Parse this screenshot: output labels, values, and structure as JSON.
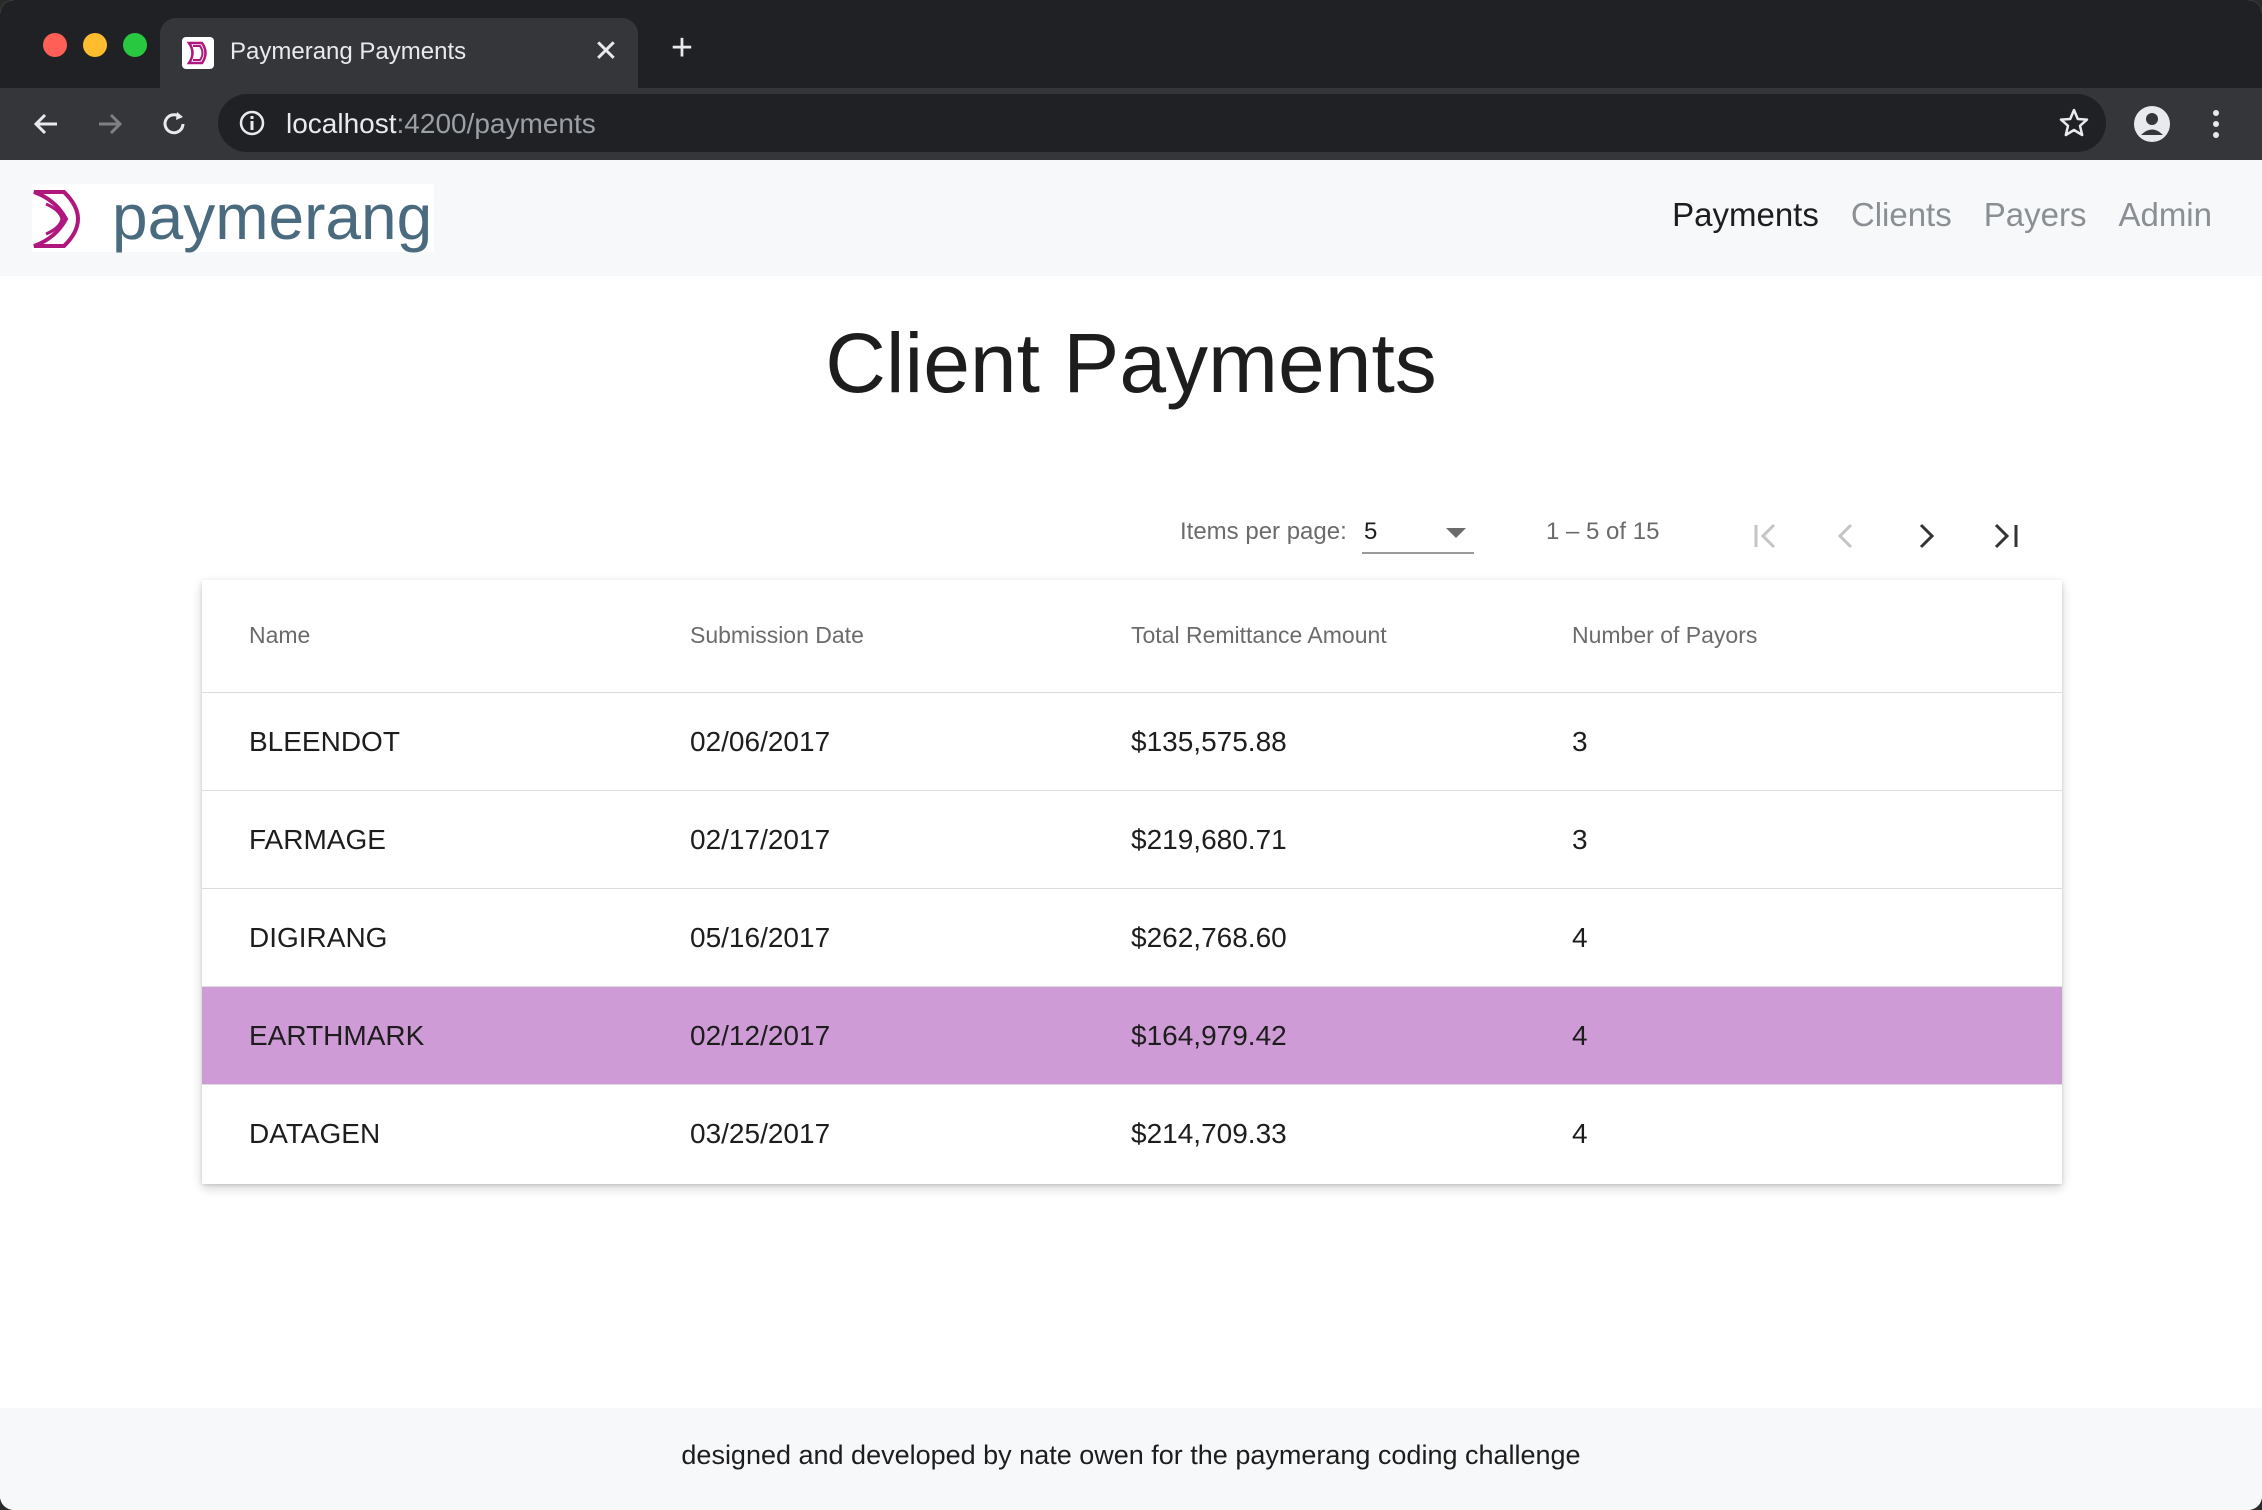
{
  "browser": {
    "tab_title": "Paymerang Payments",
    "new_tab_icon": "plus-icon",
    "url_host": "localhost",
    "url_path": ":4200/payments"
  },
  "header": {
    "logo_text": "paymerang",
    "nav": [
      {
        "label": "Payments",
        "active": true
      },
      {
        "label": "Clients",
        "active": false
      },
      {
        "label": "Payers",
        "active": false
      },
      {
        "label": "Admin",
        "active": false
      }
    ]
  },
  "main": {
    "title": "Client Payments",
    "paginator": {
      "items_per_page_label": "Items per page:",
      "items_per_page_value": "5",
      "range_label": "1 – 5 of 15"
    },
    "table": {
      "columns": [
        "Name",
        "Submission Date",
        "Total Remittance Amount",
        "Number of Payors"
      ],
      "rows": [
        [
          "BLEENDOT",
          "02/06/2017",
          "$135,575.88",
          "3"
        ],
        [
          "FARMAGE",
          "02/17/2017",
          "$219,680.71",
          "3"
        ],
        [
          "DIGIRANG",
          "05/16/2017",
          "$262,768.60",
          "4"
        ],
        [
          "EARTHMARK",
          "02/12/2017",
          "$164,979.42",
          "4"
        ],
        [
          "DATAGEN",
          "03/25/2017",
          "$214,709.33",
          "4"
        ]
      ],
      "selected_row": 3,
      "selected_color": "#ce9bd6"
    }
  },
  "footer": {
    "text": "designed and developed by nate owen for the paymerang coding challenge"
  },
  "colors": {
    "brand_magenta": "#b0177e",
    "brand_slate": "#4a6b7f"
  }
}
